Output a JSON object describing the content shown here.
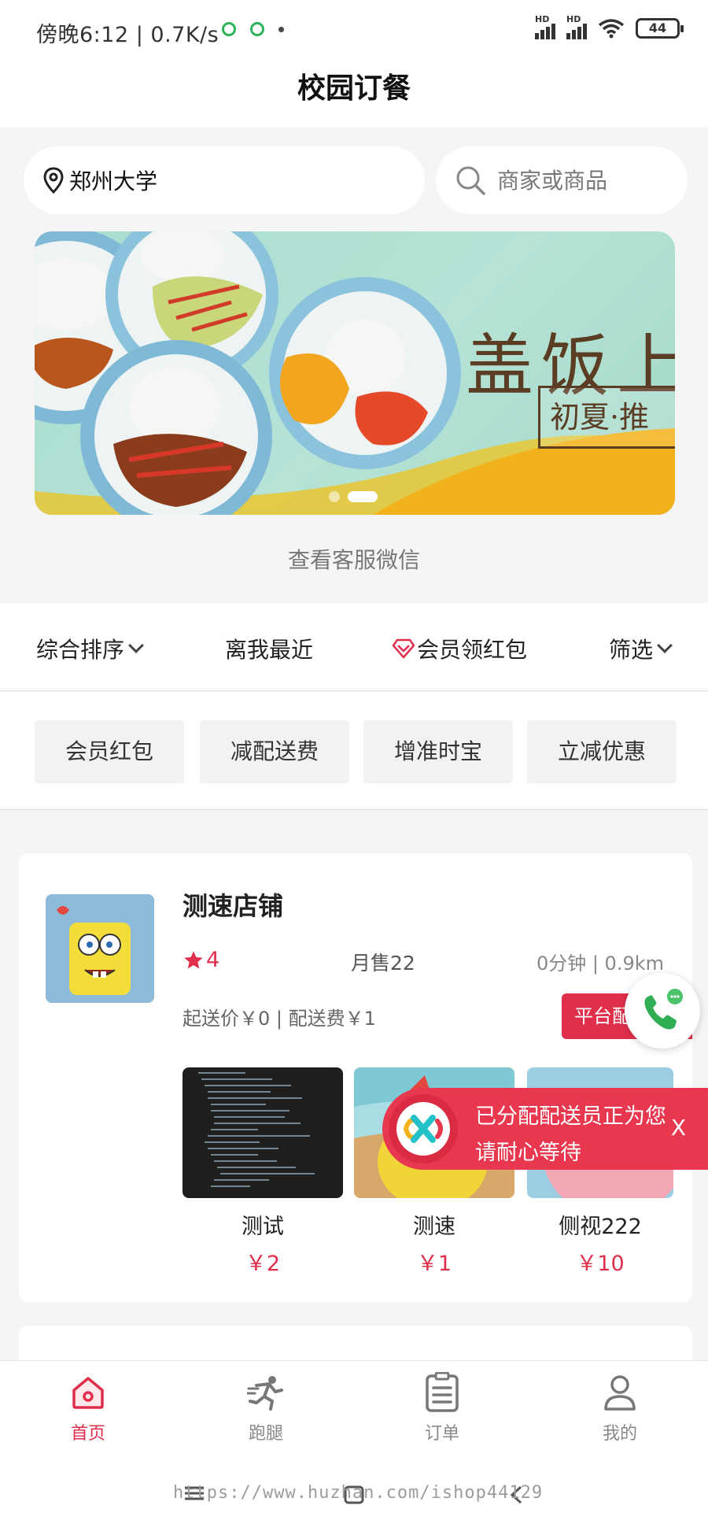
{
  "status_bar": {
    "time_speed": "傍晚6:12 | 0.7K/s",
    "network_label": "HD",
    "battery": "44"
  },
  "header": {
    "title": "校园订餐"
  },
  "location": {
    "text": "郑州大学"
  },
  "search": {
    "placeholder": "商家或商品"
  },
  "banner": {
    "headline": "盖饭上",
    "tag": "初夏·推"
  },
  "service_link": "查看客服微信",
  "sort_options": {
    "comprehensive": "综合排序",
    "nearest": "离我最近",
    "member_coupon": "会员领红包",
    "filter": "筛选"
  },
  "tags": [
    "会员红包",
    "减配送费",
    "增准时宝",
    "立减优惠"
  ],
  "store": {
    "name": "测速店铺",
    "rating": "4",
    "monthly_sales": "月售22",
    "delivery": "0分钟 | 0.9km",
    "price_info": "起送价￥0 | 配送费￥1",
    "badge": "平台配",
    "products": [
      {
        "name": "测试",
        "price": "￥2"
      },
      {
        "name": "测速",
        "price": "￥1"
      },
      {
        "name": "侧视222",
        "price": "￥10"
      }
    ]
  },
  "toast": {
    "line1": "已分配配送员正为您",
    "line2": "请耐心等待",
    "close": "X"
  },
  "bottom_nav": [
    {
      "label": "首页"
    },
    {
      "label": "跑腿"
    },
    {
      "label": "订单"
    },
    {
      "label": "我的"
    }
  ],
  "watermark": "https://www.huzhan.com/ishop44129",
  "colors": {
    "accent": "#e02f4b",
    "toast": "#e8384f",
    "banner_bg": "#a8ddd0"
  }
}
